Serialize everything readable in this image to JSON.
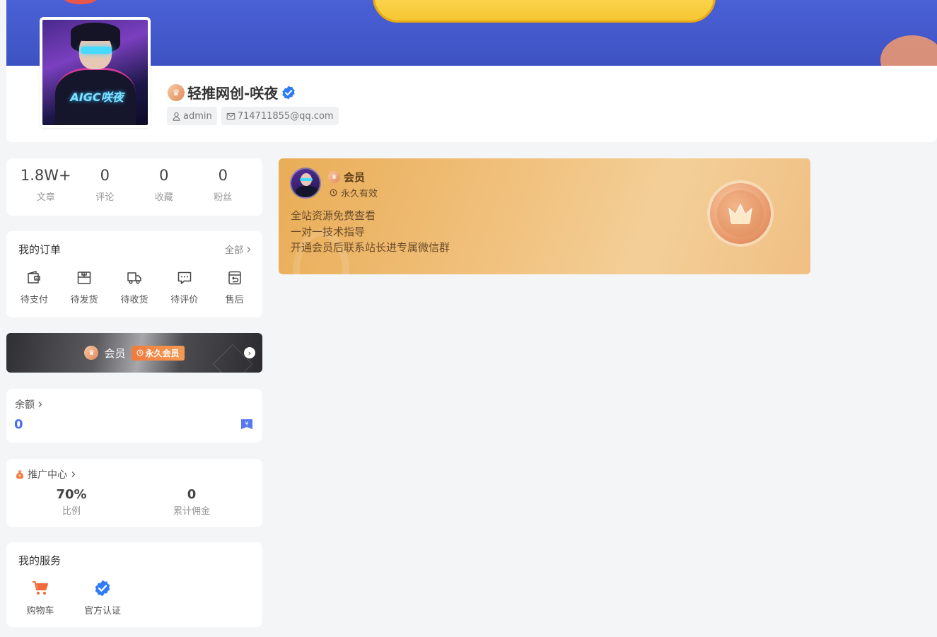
{
  "profile": {
    "name": "轻推网创-咲夜",
    "username": "admin",
    "email": "714711855@qq.com",
    "avatar_text": "AIGC咲夜"
  },
  "stats": [
    {
      "value": "1.8W+",
      "label": "文章"
    },
    {
      "value": "0",
      "label": "评论"
    },
    {
      "value": "0",
      "label": "收藏"
    },
    {
      "value": "0",
      "label": "粉丝"
    }
  ],
  "orders": {
    "title": "我的订单",
    "all_label": "全部",
    "items": [
      {
        "label": "待支付",
        "icon": "wallet-icon"
      },
      {
        "label": "待发货",
        "icon": "package-icon"
      },
      {
        "label": "待收货",
        "icon": "truck-icon"
      },
      {
        "label": "待评价",
        "icon": "comment-icon"
      },
      {
        "label": "售后",
        "icon": "return-icon"
      }
    ]
  },
  "vip_bar": {
    "label": "会员",
    "tag": "永久会员"
  },
  "balance": {
    "title": "余额",
    "value": "0"
  },
  "promo": {
    "title": "推广中心",
    "ratio_value": "70%",
    "ratio_label": "比例",
    "commission_value": "0",
    "commission_label": "累计佣金"
  },
  "services": {
    "title": "我的服务",
    "items": [
      {
        "label": "购物车",
        "icon": "cart-icon"
      },
      {
        "label": "官方认证",
        "icon": "verified-icon"
      }
    ]
  },
  "member_card": {
    "level": "会员",
    "validity": "永久有效",
    "benefits": [
      "全站资源免费查看",
      "一对一技术指导",
      "开通会员后联系站长进专属微信群"
    ]
  },
  "colors": {
    "banner": "#4a61d6",
    "accent_blue": "#4b6bf0",
    "vip_orange": "#f07b3f",
    "member_gold": "#f1c27f"
  }
}
